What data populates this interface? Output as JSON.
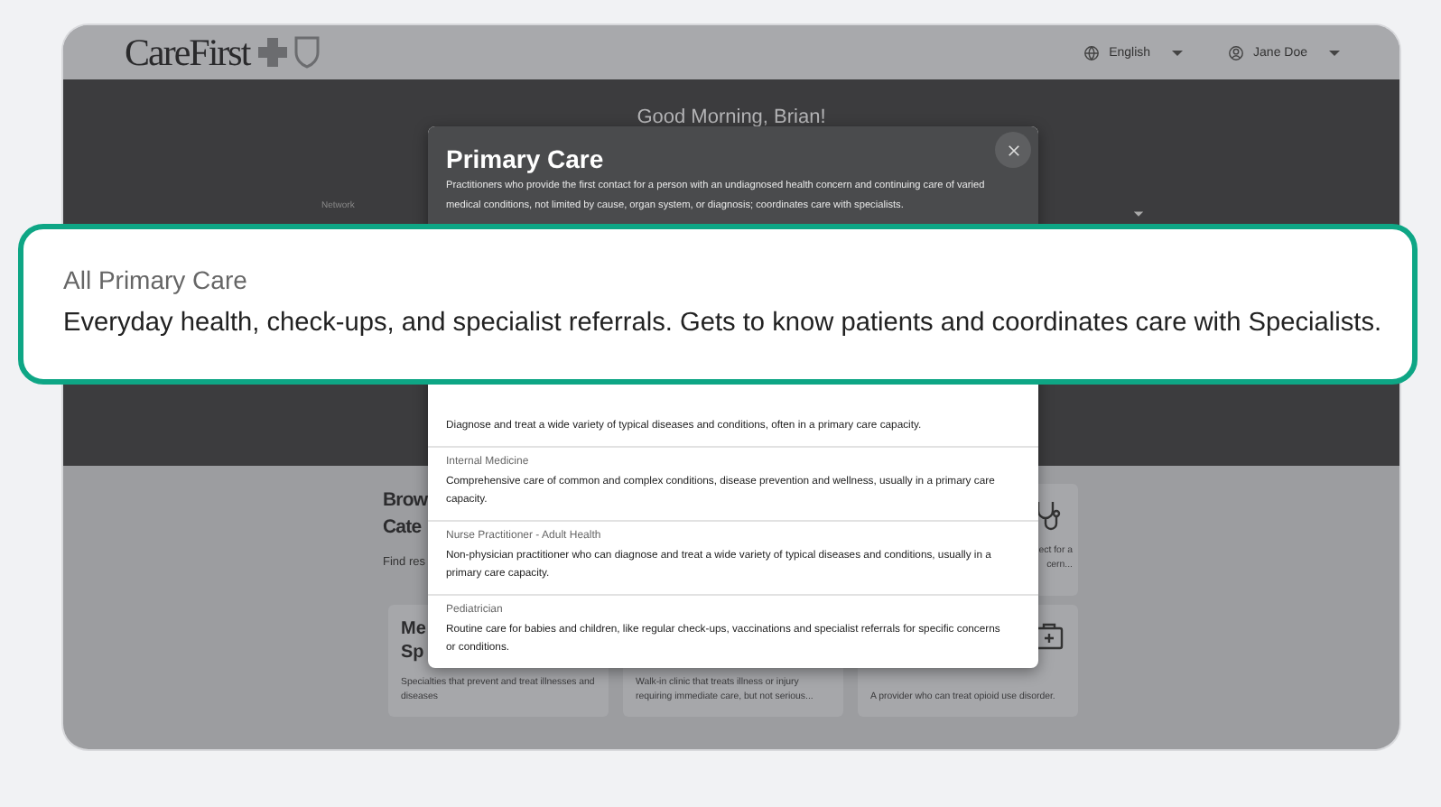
{
  "header": {
    "logo": "CareFirst",
    "language": "English",
    "user": "Jane Doe"
  },
  "hero": {
    "greeting": "Good Morning, Brian!",
    "network_label": "Network"
  },
  "browse": {
    "heading_lines": [
      "Brow",
      "Cate"
    ],
    "subtitle": "Find res",
    "cards": [
      {
        "description_lines": [
          "ect for a",
          "cern..."
        ]
      },
      {
        "title_lines": [
          "Me",
          "Sp"
        ],
        "description_lines": [
          "Specialties that prevent and treat illnesses and",
          "diseases"
        ]
      },
      {
        "description_lines": [
          "Walk-in clinic that treats illness or injury",
          "requiring immediate care, but not serious..."
        ]
      },
      {
        "description_lines": [
          "A provider who can treat opioid use disorder."
        ]
      }
    ]
  },
  "modal": {
    "title": "Primary Care",
    "description": "Practitioners who provide the first contact for a person with an undiagnosed health concern and continuing care of varied medical conditions, not limited by cause, organ system, or diagnosis; coordinates care with specialists.",
    "items": [
      {
        "description": "Diagnose and treat a wide variety of typical diseases and conditions, often in a primary care capacity."
      },
      {
        "title": "Internal Medicine",
        "description": "Comprehensive care of common and complex conditions, disease prevention and wellness, usually in a primary care capacity."
      },
      {
        "title": "Nurse Practitioner - Adult Health",
        "description": "Non-physician practitioner who can diagnose and treat a wide variety of typical diseases and conditions, usually in a primary care capacity."
      },
      {
        "title": "Pediatrician",
        "description": "Routine care for babies and children, like regular check-ups, vaccinations and specialist referrals for specific concerns or conditions."
      }
    ]
  },
  "callout": {
    "title": "All Primary Care",
    "description": "Everyday health, check-ups, and specialist referrals. Gets to know patients and coordinates care with Specialists."
  }
}
